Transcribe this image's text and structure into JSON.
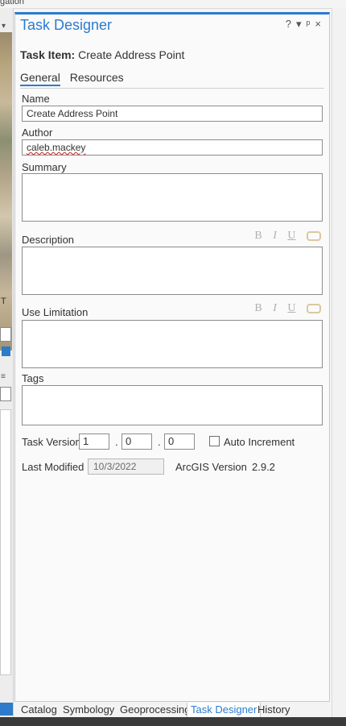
{
  "top_tab": "gation",
  "left_text": {
    "t": "T"
  },
  "panel": {
    "title": "Task Designer",
    "controls": "? ▾ ᵖ ×"
  },
  "task_item": {
    "label": "Task Item:",
    "value": "Create Address Point"
  },
  "tabs": [
    "General",
    "Resources"
  ],
  "fields": {
    "name_label": "Name",
    "name_value": "Create Address Point",
    "author_label": "Author",
    "author_value": "caleb.mackey",
    "summary_label": "Summary",
    "description_label": "Description",
    "use_limitation_label": "Use Limitation",
    "tags_label": "Tags"
  },
  "format_buttons": {
    "bold": "B",
    "italic": "I",
    "underline": "U"
  },
  "task_version": {
    "label": "Task Version",
    "major": "1",
    "minor": "0",
    "patch": "0",
    "sep": ".",
    "auto_increment_label": "Auto Increment"
  },
  "last_modified": {
    "label": "Last Modified",
    "value": "10/3/2022",
    "arcgis_label": "ArcGIS Version",
    "arcgis_value": "2.9.2"
  },
  "bottom_tabs": [
    "Catalog",
    "Symbology",
    "Geoprocessing",
    "Task Designer",
    "History"
  ]
}
